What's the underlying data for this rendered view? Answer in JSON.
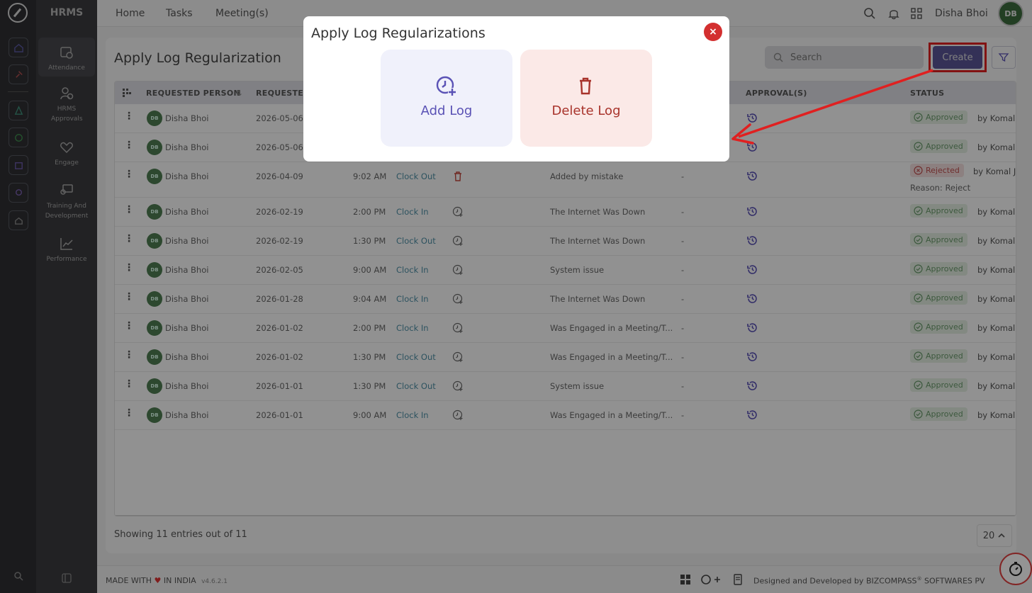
{
  "app": {
    "brand": "HRMS"
  },
  "top_nav": {
    "items": [
      "Home",
      "Tasks",
      "Meeting(s)"
    ],
    "user_name": "Disha Bhoi",
    "user_initials": "DB"
  },
  "sidebar": {
    "items": [
      {
        "label": "Attendance",
        "icon": "calendar-clock-icon",
        "active": true
      },
      {
        "label": "HRMS Approvals",
        "icon": "user-check-icon"
      },
      {
        "label": "Engage",
        "icon": "heart-hand-icon"
      },
      {
        "label": "Training And Development",
        "icon": "presentation-icon"
      },
      {
        "label": "Performance",
        "icon": "chart-line-icon"
      }
    ]
  },
  "page": {
    "title": "Apply Log Regularization",
    "search_placeholder": "Search",
    "create_label": "Create"
  },
  "table": {
    "headers": [
      "REQUESTED PERSON",
      "REQUESTED",
      "APPROVAL(S)",
      "STATUS"
    ],
    "rows": [
      {
        "initials": "DB",
        "name": "Disha Bhoi",
        "date": "2026-05-06",
        "time": "",
        "type": "",
        "action": "",
        "reason": "",
        "remark": "",
        "status": "Approved",
        "by": "by Komal"
      },
      {
        "initials": "DB",
        "name": "Disha Bhoi",
        "date": "2026-05-06",
        "time": "",
        "type": "",
        "action": "",
        "reason": "",
        "remark": "",
        "status": "Approved",
        "by": "by Komal"
      },
      {
        "initials": "DB",
        "name": "Disha Bhoi",
        "date": "2026-04-09",
        "time": "9:02 AM",
        "type": "Clock Out",
        "action": "delete",
        "reason": "Added by mistake",
        "remark": "-",
        "status": "Rejected",
        "by": "by Komal J",
        "status_reason": "Reason: Reject"
      },
      {
        "initials": "DB",
        "name": "Disha Bhoi",
        "date": "2026-02-19",
        "time": "2:00 PM",
        "type": "Clock In",
        "action": "add",
        "reason": "The Internet Was Down",
        "remark": "-",
        "status": "Approved",
        "by": "by Komal"
      },
      {
        "initials": "DB",
        "name": "Disha Bhoi",
        "date": "2026-02-19",
        "time": "1:30 PM",
        "type": "Clock Out",
        "action": "add",
        "reason": "The Internet Was Down",
        "remark": "-",
        "status": "Approved",
        "by": "by Komal"
      },
      {
        "initials": "DB",
        "name": "Disha Bhoi",
        "date": "2026-02-05",
        "time": "9:00 AM",
        "type": "Clock In",
        "action": "add",
        "reason": "System issue",
        "remark": "-",
        "status": "Approved",
        "by": "by Komal"
      },
      {
        "initials": "DB",
        "name": "Disha Bhoi",
        "date": "2026-01-28",
        "time": "9:04 AM",
        "type": "Clock In",
        "action": "add",
        "reason": "The Internet Was Down",
        "remark": "-",
        "status": "Approved",
        "by": "by Komal"
      },
      {
        "initials": "DB",
        "name": "Disha Bhoi",
        "date": "2026-01-02",
        "time": "2:00 PM",
        "type": "Clock In",
        "action": "add",
        "reason": "Was Engaged in a Meeting/T...",
        "remark": "-",
        "status": "Approved",
        "by": "by Komal"
      },
      {
        "initials": "DB",
        "name": "Disha Bhoi",
        "date": "2026-01-02",
        "time": "1:30 PM",
        "type": "Clock Out",
        "action": "add",
        "reason": "Was Engaged in a Meeting/T...",
        "remark": "-",
        "status": "Approved",
        "by": "by Komal"
      },
      {
        "initials": "DB",
        "name": "Disha Bhoi",
        "date": "2026-01-01",
        "time": "1:30 PM",
        "type": "Clock Out",
        "action": "add",
        "reason": "System issue",
        "remark": "-",
        "status": "Approved",
        "by": "by Komal"
      },
      {
        "initials": "DB",
        "name": "Disha Bhoi",
        "date": "2026-01-01",
        "time": "9:00 AM",
        "type": "Clock In",
        "action": "add",
        "reason": "Was Engaged in a Meeting/T...",
        "remark": "-",
        "status": "Approved",
        "by": "by Komal"
      }
    ]
  },
  "pagination": {
    "summary": "Showing 11 entries out of 11",
    "page_size": "20"
  },
  "footer": {
    "made_with_prefix": "MADE WITH",
    "made_with_suffix": "IN INDIA",
    "version": "v4.6.2.1",
    "credit": "Designed and Developed by",
    "company": "BIZCOMPASS",
    "company_suffix": "SOFTWARES PV"
  },
  "modal": {
    "title": "Apply Log Regularizations",
    "close_label": "×",
    "options": [
      {
        "label": "Add Log",
        "icon": "clock-plus-icon"
      },
      {
        "label": "Delete Log",
        "icon": "trash-icon"
      }
    ]
  },
  "colors": {
    "accent": "#5a52b5",
    "danger": "#d32f2f",
    "highlight": "#e02020",
    "approved": "#6a9a6b",
    "rejected": "#c05050"
  }
}
